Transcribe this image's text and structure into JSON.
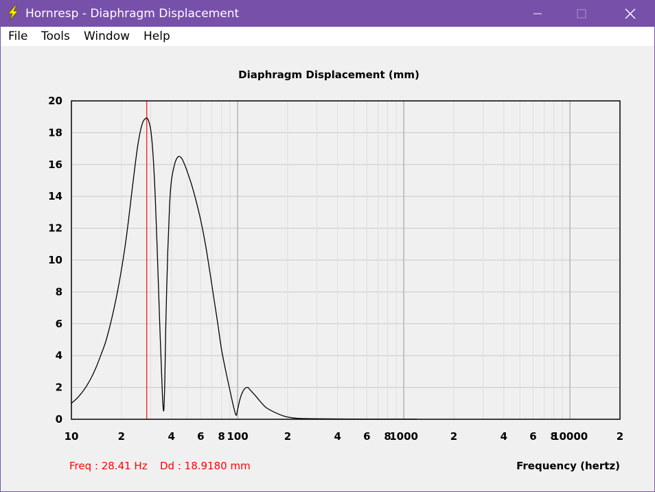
{
  "window": {
    "title": "Hornresp - Diaphragm Displacement",
    "app_icon": "lightning-bolt-icon",
    "colors": {
      "titlebar": "#7750aa",
      "plot_line": "#000000",
      "marker": "#ff0000",
      "grid": "#c8c8c8"
    }
  },
  "menu": {
    "items": [
      {
        "label": "File",
        "name": "menu-file"
      },
      {
        "label": "Tools",
        "name": "menu-tools"
      },
      {
        "label": "Window",
        "name": "menu-window"
      },
      {
        "label": "Help",
        "name": "menu-help"
      }
    ]
  },
  "readout": {
    "freq": "Freq : 28.41 Hz",
    "dd": "Dd : 18.9180 mm"
  },
  "chart_data": {
    "type": "line",
    "title": "Diaphragm Displacement (mm)",
    "xlabel": "Frequency (hertz)",
    "ylabel": "",
    "x_scale": "log",
    "xlim": [
      10,
      20000
    ],
    "ylim": [
      0,
      20
    ],
    "grid": true,
    "y_ticks": [
      "0",
      "2",
      "4",
      "6",
      "8",
      "10",
      "12",
      "14",
      "16",
      "18",
      "20"
    ],
    "x_ticks": [
      {
        "value": 10,
        "label": "10"
      },
      {
        "value": 20,
        "label": "2"
      },
      {
        "value": 40,
        "label": "4"
      },
      {
        "value": 60,
        "label": "6"
      },
      {
        "value": 80,
        "label": "8"
      },
      {
        "value": 100,
        "label": "100"
      },
      {
        "value": 200,
        "label": "2"
      },
      {
        "value": 400,
        "label": "4"
      },
      {
        "value": 600,
        "label": "6"
      },
      {
        "value": 800,
        "label": "8"
      },
      {
        "value": 1000,
        "label": "1000"
      },
      {
        "value": 2000,
        "label": "2"
      },
      {
        "value": 4000,
        "label": "4"
      },
      {
        "value": 6000,
        "label": "6"
      },
      {
        "value": 8000,
        "label": "8"
      },
      {
        "value": 10000,
        "label": "10000"
      },
      {
        "value": 20000,
        "label": "2"
      }
    ],
    "marker_freq": 28.41,
    "series": [
      {
        "x": [
          10,
          11,
          12,
          13,
          14,
          15,
          16,
          17,
          18,
          19,
          20,
          21,
          22,
          23,
          24,
          25,
          26,
          27,
          28,
          28.41,
          29,
          30,
          31,
          32,
          33,
          34,
          35,
          35.5,
          36,
          36.5,
          37,
          38,
          39,
          40,
          42,
          44,
          46,
          48,
          50,
          53,
          56,
          60,
          64,
          68,
          72,
          76,
          80,
          85,
          90,
          95,
          98,
          100,
          103,
          106,
          110,
          115,
          120,
          130,
          140,
          150,
          170,
          190,
          210,
          230,
          260,
          300,
          400,
          600,
          1000,
          1200
        ],
        "y": [
          1.0,
          1.4,
          1.9,
          2.5,
          3.2,
          4.0,
          4.8,
          5.8,
          6.9,
          8.1,
          9.4,
          10.8,
          12.4,
          14.1,
          15.7,
          17.1,
          18.1,
          18.7,
          18.9,
          18.92,
          18.8,
          18.2,
          16.6,
          13.8,
          10.0,
          6.0,
          2.5,
          1.0,
          0.6,
          2.5,
          6.0,
          10.5,
          13.5,
          15.0,
          16.1,
          16.5,
          16.4,
          16.0,
          15.5,
          14.7,
          13.8,
          12.5,
          11.0,
          9.3,
          7.6,
          6.0,
          4.4,
          3.0,
          1.8,
          0.7,
          0.25,
          0.6,
          1.2,
          1.6,
          1.9,
          2.0,
          1.8,
          1.4,
          1.0,
          0.7,
          0.4,
          0.2,
          0.1,
          0.06,
          0.04,
          0.03,
          0.02,
          0.01,
          0.01,
          0.01
        ]
      }
    ]
  }
}
